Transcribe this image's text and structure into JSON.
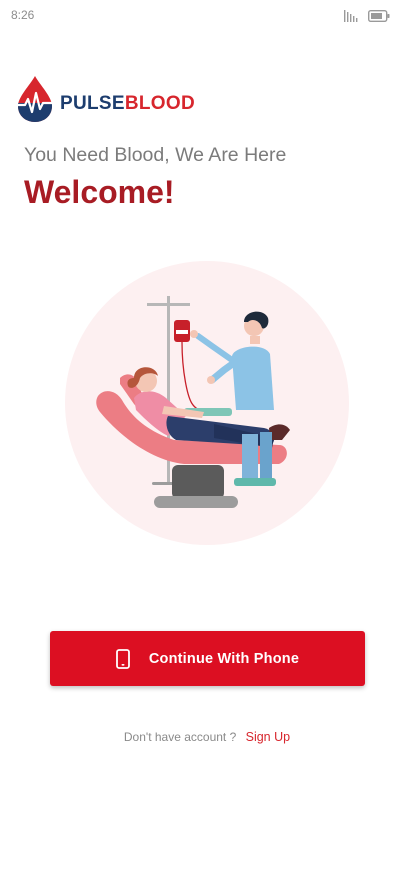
{
  "status_bar": {
    "time": "8:26",
    "icons": [
      "signal-icon",
      "battery-icon"
    ]
  },
  "logo": {
    "icon": "blood-drop-pulse-icon",
    "text_part1": "PULSE",
    "text_part2": "BLOOD"
  },
  "tagline": "You Need Blood, We Are Here",
  "welcome": "Welcome!",
  "illustration": {
    "name": "blood-donation-illustration"
  },
  "primary_button": {
    "icon": "smartphone-icon",
    "label": "Continue With Phone"
  },
  "signup": {
    "prompt": "Don't have account ?",
    "link": "Sign Up"
  },
  "colors": {
    "brand_red": "#dc0f22",
    "welcome_red": "#a81c24",
    "logo_navy": "#1d3d6e",
    "text_gray": "#7b7b7b"
  }
}
